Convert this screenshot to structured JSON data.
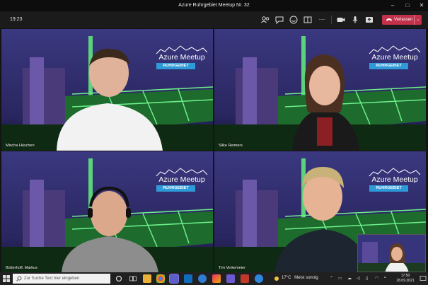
{
  "window": {
    "title": "Azure Ruhrgebiet Meetup Nr. 32",
    "controls": [
      "–",
      "□",
      "✕"
    ]
  },
  "toolbar": {
    "time": "19:23",
    "leave_label": "Verlassen"
  },
  "logo": {
    "line1": "Azure Meetup",
    "line2": "RUHRGEBIET"
  },
  "participants": [
    {
      "name": "Mischa Hüschen"
    },
    {
      "name": "Silke Reimers"
    },
    {
      "name": "Bütterhoff, Markus"
    },
    {
      "name": "Tim Vinkemeier"
    }
  ],
  "taskbar": {
    "search_placeholder": "Zur Suche Text hier eingeben",
    "weather_temp": "17°C",
    "weather_text": "Meist sonnig",
    "clock_time": "17:50",
    "clock_date": "28.09.2021"
  },
  "colors": {
    "leave": "#c4314b",
    "logo_blue": "#2f9ad8",
    "sky": "#2c2a5a",
    "green_light": "#4cd964"
  }
}
